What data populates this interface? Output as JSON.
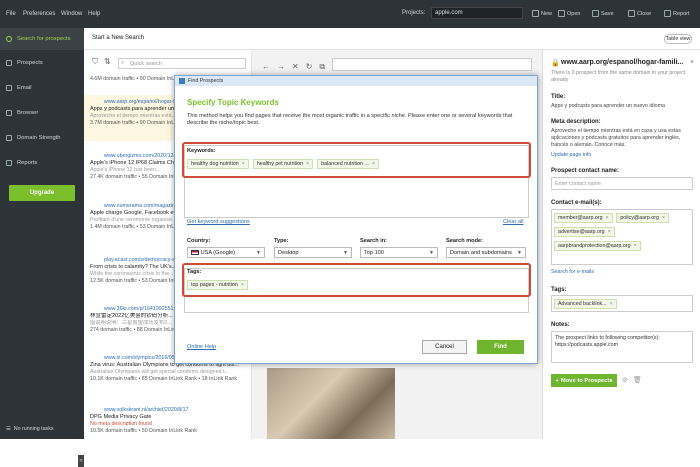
{
  "menu": [
    "File",
    "Preferences",
    "Window",
    "Help"
  ],
  "toolbar": {
    "projects_label": "Projects:",
    "project_value": "apple.com",
    "new_label": "New",
    "open_label": "Open",
    "save_label": "Save",
    "close_label": "Close",
    "report_label": "Report"
  },
  "sidebar": {
    "items": [
      {
        "label": "Search for prospects"
      },
      {
        "label": "Prospects"
      },
      {
        "label": "Email"
      },
      {
        "label": "Browser"
      },
      {
        "label": "Domain Strength"
      },
      {
        "label": "Reports"
      }
    ],
    "upgrade_label": "Upgrade",
    "no_tasks_label": "No running tasks",
    "collapse_label": "«"
  },
  "search_header": {
    "title": "Start a New Search",
    "table_view_label": "Table view"
  },
  "results": {
    "quick_search_placeholder": "Quick search",
    "items": [
      {
        "url": "",
        "title": "",
        "desc": "",
        "meta": "4.6M domain traffic • 90 Domain InLink Rank"
      },
      {
        "url": "www.aarp.org/espanol/hogar-fam...",
        "title": "Apps y podcasts para aprender un...",
        "desc": "Aproveche el tiempo mientras está...",
        "meta": "3.7M domain traffic • 90 Domain InLink Rank"
      },
      {
        "url": "www.ubergizmo.com/2020/12/...",
        "title": "Apple's iPhone 12 IP68 Claims Ch...",
        "desc": "Apple's iPhone 12 has been...",
        "meta": "27.4K domain traffic • 55 Domain InLink Rank"
      },
      {
        "url": "www.numerama.com/magazine/...",
        "title": "Apple charge Google, Facebook et...",
        "desc": "Profitant d'une cérémonie organisé...",
        "meta": "1.4M domain traffic • 53 Domain InLink Rank"
      },
      {
        "url": "play.acast.com/s/democracy-a...",
        "title": "From crisis to calamity? The UK's...",
        "desc": "While the coronavirus crisis in the...",
        "meta": "12.5K domain traffic • 53 Domain InLink Rank"
      },
      {
        "url": "www.36kr.com/p/1641992551...",
        "title": "林宣雷定2022亿美金的钞码分析...",
        "desc": "图说明说明：三星有望成功发布2...",
        "meta": "274 domain traffic • 88 Domain InLink Rank"
      },
      {
        "url": "www.sl.com/olympics/2016/05...",
        "title": "Zina virus: Australian Olympians to get condoms to fight dis...",
        "desc": "Australian Olympians will get special condoms designed t...",
        "meta": "10.1K domain traffic • 85 Domain InLink Rank • 18 InLink Rank"
      },
      {
        "url": "www.volkskrant.nl/archief/2020/8/17",
        "title": "DPG Media Privacy Gate",
        "desc": "No meta description found",
        "meta": "10.5K domain traffic • 50 Domain InLink Rank"
      }
    ]
  },
  "details": {
    "page_title": "www.aarp.org/espanol/hogar-famili...",
    "notice": "There is 0 prospect from the same domain in your project already",
    "title_label": "Title:",
    "title_value": "Apps y podcasts para aprender un nuevo idioma",
    "meta_label": "Meta description:",
    "meta_value": "Aproveche el tiempo mientras está en casa y usa estas aplicaciones y podcasts gratuitos para aprender inglés, francés o alemán. Conoce más.",
    "update_link": "Update page info",
    "contact_label": "Prospect contact name:",
    "contact_placeholder": "Enter contact name",
    "emails_label": "Contact e-mail(s):",
    "emails": [
      "member@aarp.org",
      "policy@aarp.org",
      "advertise@aarp.org",
      "aarpbrandprotection@aarp.org"
    ],
    "search_emails_link": "Search for e-mails",
    "tags_label": "Tags:",
    "tags": [
      "Advanced backlink..."
    ],
    "notes_label": "Notes:",
    "notes_value": "The prospect links to following competitor(s): https://podcasts.apple.com",
    "move_label": "Move to Prospects"
  },
  "dialog": {
    "window_title": "Find Prospects",
    "heading": "Specify Topic Keywords",
    "description": "This method helps you find pages that receive the most organic traffic in a specific niche. Please enter one or several keywords that describe the niche/topic best.",
    "keywords_label": "Keywords:",
    "keywords": [
      "healthy dog nutrition",
      "healthy pet nutrition",
      "balanced nutrition ..."
    ],
    "suggest_link": "Get keyword suggestions",
    "clear_link": "Clear all",
    "country_label": "Country:",
    "country_value": "USA (Google)",
    "type_label": "Type:",
    "type_value": "Desktop",
    "search_in_label": "Search in:",
    "search_in_value": "Top 100",
    "mode_label": "Search mode:",
    "mode_value": "Domain and subdomains",
    "tags_label": "Tags:",
    "tags": [
      "top pages - nutrition"
    ],
    "help_link": "Online Help",
    "cancel_label": "Cancel",
    "find_label": "Find"
  },
  "colors": {
    "accent": "#7bbf2d",
    "sidebar": "#2d3438",
    "highlight_box": "#d04b35",
    "link": "#2a6db5"
  }
}
